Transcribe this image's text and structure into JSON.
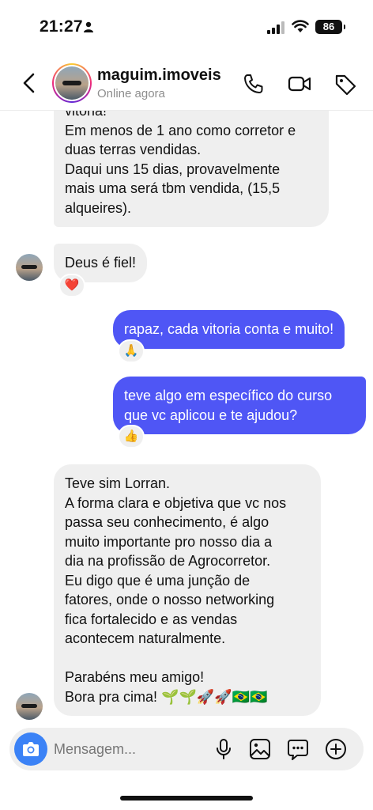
{
  "status_bar": {
    "time": "21:27",
    "battery": "86"
  },
  "header": {
    "name": "maguim.imoveis",
    "status": "Online agora"
  },
  "messages": [
    {
      "sender": "contact",
      "lines": [
        "vitória!",
        "Em menos de 1 ano como corretor e",
        "duas terras vendidas.",
        "Daqui uns 15 dias, provavelmente",
        "mais uma será tbm vendida, (15,5",
        "alqueires)."
      ]
    },
    {
      "sender": "contact",
      "lines": [
        "Deus é fiel!"
      ],
      "reaction": "❤️"
    },
    {
      "sender": "me",
      "lines": [
        "rapaz, cada vitoria conta e muito!"
      ],
      "reaction": "🙏"
    },
    {
      "sender": "me",
      "lines": [
        "teve algo em específico do curso",
        "que vc aplicou e te ajudou?"
      ],
      "reaction": "👍"
    },
    {
      "sender": "contact",
      "lines": [
        "Teve sim Lorran.",
        "A forma clara e objetiva que vc nos",
        "passa seu conhecimento, é algo",
        "muito importante pro nosso dia a",
        "dia na profissão de Agrocorretor.",
        "Eu digo que é uma junção de",
        "fatores, onde o nosso networking",
        "fica fortalecido e as vendas",
        "acontecem naturalmente.",
        "",
        "Parabéns meu amigo!",
        "Bora pra cima! 🌱🌱🚀🚀🇧🇷🇧🇷"
      ]
    }
  ],
  "composer": {
    "placeholder": "Mensagem..."
  },
  "colors": {
    "outgoing_bubble": "#4f56f5",
    "incoming_bubble": "#efefef",
    "camera_button": "#3b82f6"
  }
}
